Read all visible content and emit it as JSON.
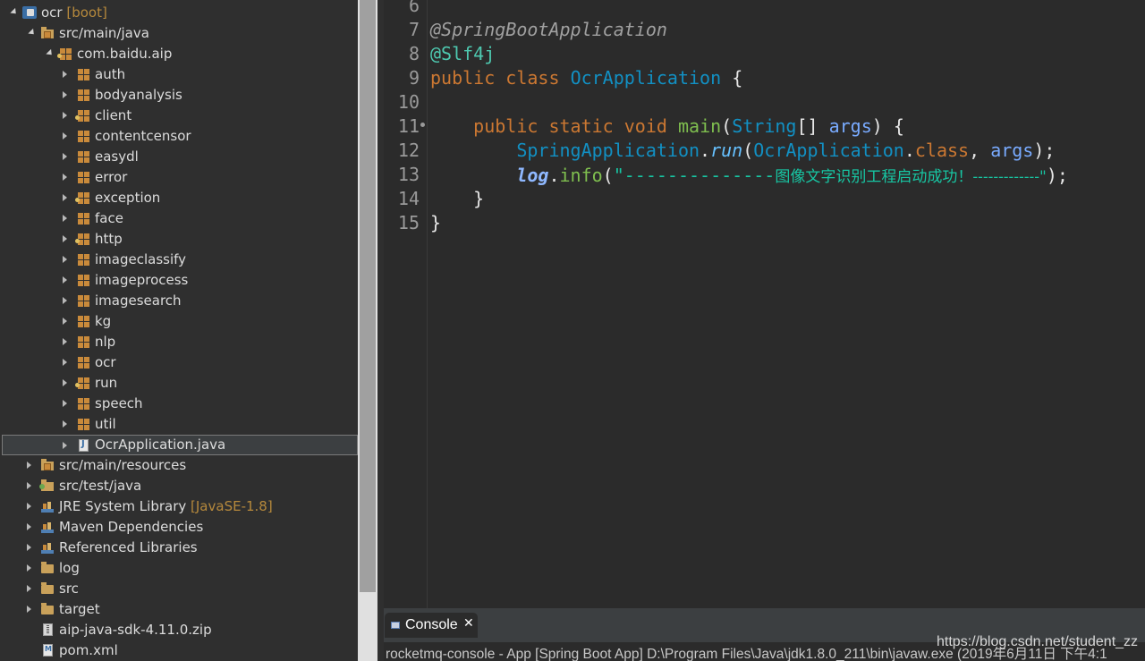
{
  "explorer": {
    "project": {
      "name": "ocr",
      "decoration": "[boot]"
    },
    "source_folder": "src/main/java",
    "root_package": "com.baidu.aip",
    "packages": [
      "auth",
      "bodyanalysis",
      "client",
      "contentcensor",
      "easydl",
      "error",
      "exception",
      "face",
      "http",
      "imageclassify",
      "imageprocess",
      "imagesearch",
      "kg",
      "nlp",
      "ocr",
      "run",
      "speech",
      "util"
    ],
    "selected_file": "OcrApplication.java",
    "other_nodes": [
      {
        "label": "src/main/resources",
        "decoration": ""
      },
      {
        "label": "src/test/java",
        "decoration": ""
      },
      {
        "label": "JRE System Library",
        "decoration": "[JavaSE-1.8]"
      },
      {
        "label": "Maven Dependencies",
        "decoration": ""
      },
      {
        "label": "Referenced Libraries",
        "decoration": ""
      },
      {
        "label": "log",
        "decoration": ""
      },
      {
        "label": "src",
        "decoration": ""
      },
      {
        "label": "target",
        "decoration": ""
      },
      {
        "label": "aip-java-sdk-4.11.0.zip",
        "decoration": ""
      },
      {
        "label": "pom.xml",
        "decoration": ""
      }
    ]
  },
  "editor": {
    "line_numbers": [
      "6",
      "7",
      "8",
      "9",
      "10",
      "11",
      "12",
      "13",
      "14",
      "15"
    ],
    "lines": {
      "l7": {
        "anno": "@SpringBootApplication"
      },
      "l8": {
        "anno": "@Slf4j"
      },
      "l9": {
        "kw1": "public",
        "kw2": "class",
        "type": "OcrApplication",
        "brace": "{"
      },
      "l11": {
        "kw1": "public",
        "kw2": "static",
        "kw3": "void",
        "method": "main",
        "open": "(",
        "type": "String",
        "arr": "[]",
        "param": "args",
        "close": ") {"
      },
      "l12": {
        "type": "SpringApplication",
        "dot": ".",
        "method": "run",
        "open": "(",
        "type2": "OcrApplication",
        "dot2": ".",
        "kw": "class",
        "comma": ",",
        "param": "args",
        "close": ");"
      },
      "l13": {
        "field": "log",
        "dot": ".",
        "method": "info",
        "open": "(",
        "str1": "\"--------------",
        "str_cjk": "图像文字识别工程启动成功！",
        "str2": "-------------\"",
        "close": ");"
      },
      "l14": {
        "brace": "}"
      },
      "l15": {
        "brace": "}"
      }
    }
  },
  "console": {
    "tab_label": "Console",
    "description": "rocketmq-console - App [Spring Boot App] D:\\Program Files\\Java\\jdk1.8.0_211\\bin\\javaw.exe (2019年6月11日 下午4:1"
  },
  "watermark": "https://blog.csdn.net/student_zz"
}
